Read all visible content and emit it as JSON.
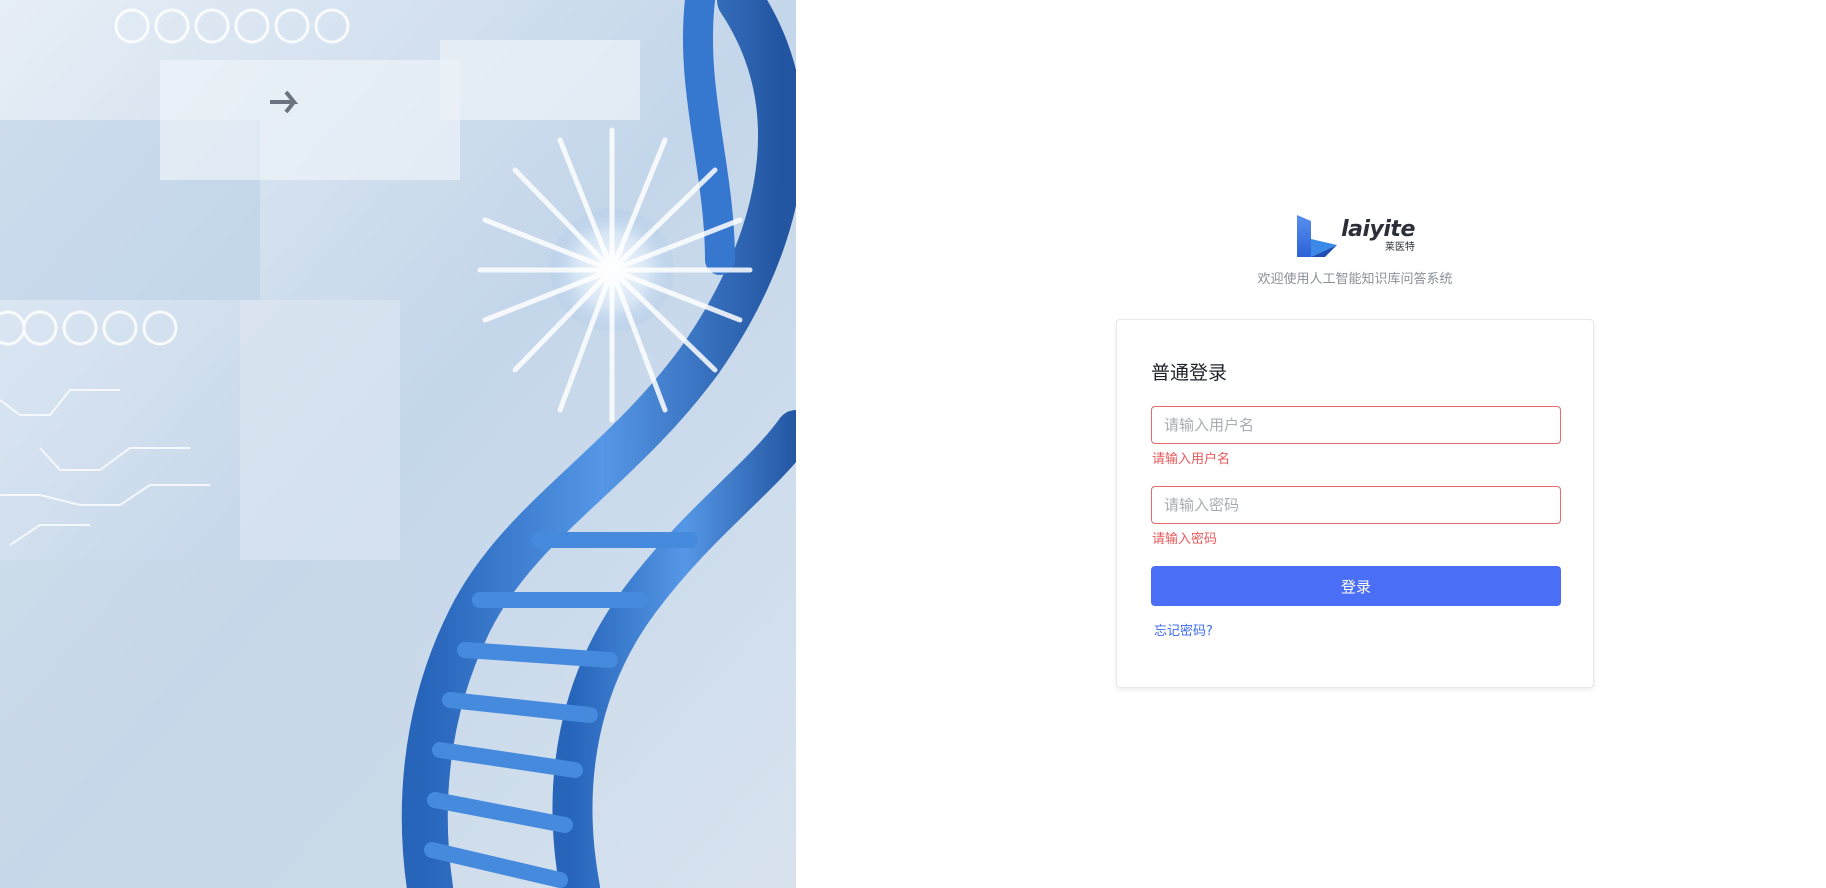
{
  "brand": {
    "logo_word": "laiyite",
    "logo_sub": "莱医特",
    "welcome": "欢迎使用人工智能知识库问答系统"
  },
  "login": {
    "title": "普通登录",
    "username_placeholder": "请输入用户名",
    "username_error": "请输入用户名",
    "password_placeholder": "请输入密码",
    "password_error": "请输入密码",
    "submit_label": "登录",
    "forgot_label": "忘记密码?"
  },
  "colors": {
    "primary": "#4a6ef5",
    "error": "#e8595c",
    "link": "#3c6cf0"
  }
}
